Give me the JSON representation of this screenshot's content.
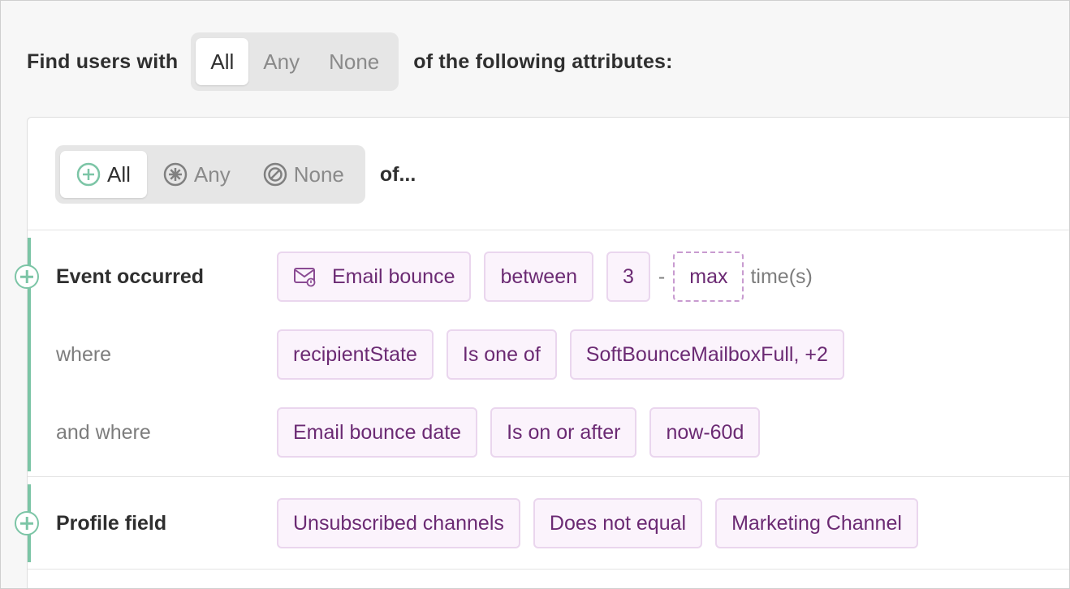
{
  "top": {
    "lead": "Find users with",
    "options": [
      "All",
      "Any",
      "None"
    ],
    "selected": "All",
    "trail": "of the following attributes:"
  },
  "group": {
    "options": [
      {
        "label": "All",
        "icon": "plus-circle-icon"
      },
      {
        "label": "Any",
        "icon": "asterisk-circle-icon"
      },
      {
        "label": "None",
        "icon": "prohibited-circle-icon"
      }
    ],
    "selected": "All",
    "trail": "of..."
  },
  "event_block": {
    "label": "Event occurred",
    "event_chip": "Email bounce",
    "event_icon": "email-bounce-icon",
    "operator": "between",
    "min": "3",
    "dash": "-",
    "max": "max",
    "unit": "time(s)",
    "where": {
      "label": "where",
      "field": "recipientState",
      "operator": "Is one of",
      "value": "SoftBounceMailboxFull, +2"
    },
    "and_where": {
      "label": "and where",
      "field": "Email bounce date",
      "operator": "Is on or after",
      "value": "now-60d"
    }
  },
  "profile_block": {
    "label": "Profile field",
    "field": "Unsubscribed channels",
    "operator": "Does not equal",
    "value": "Marketing Channel"
  },
  "colors": {
    "accent_green": "#7cc5a6",
    "chip_text": "#6b2a73",
    "chip_bg": "#fbf3fc",
    "chip_border": "#ead6ee"
  }
}
